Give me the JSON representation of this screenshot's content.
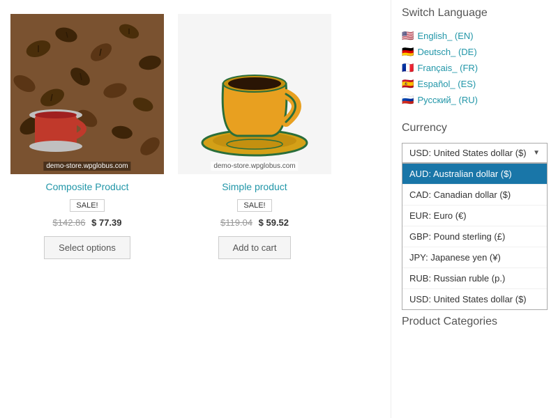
{
  "sidebar": {
    "switch_language_title": "Switch Language",
    "languages": [
      {
        "flag": "🇺🇸",
        "label": "English_ (EN)"
      },
      {
        "flag": "🇩🇪",
        "label": "Deutsch_ (DE)"
      },
      {
        "flag": "🇫🇷",
        "label": "Français_ (FR)"
      },
      {
        "flag": "🇪🇸",
        "label": "Español_ (ES)"
      },
      {
        "flag": "🇷🇺",
        "label": "Русский_ (RU)"
      }
    ],
    "currency_title": "Currency",
    "currency_selected": "USD: United States dollar ($)",
    "currency_options": [
      {
        "label": "AUD: Australian dollar ($)",
        "highlighted": true
      },
      {
        "label": "CAD: Canadian dollar ($)",
        "highlighted": false
      },
      {
        "label": "EUR: Euro (€)",
        "highlighted": false
      },
      {
        "label": "GBP: Pound sterling (£)",
        "highlighted": false
      },
      {
        "label": "JPY: Japanese yen (¥)",
        "highlighted": false
      },
      {
        "label": "RUB: Russian ruble (р.)",
        "highlighted": false
      },
      {
        "label": "USD: United States dollar ($)",
        "highlighted": false
      }
    ],
    "product_categories_title": "Product Categories"
  },
  "products": [
    {
      "title": "Composite Product",
      "badge": "SALE!",
      "old_price": "$142.86",
      "new_price": "$ 77.39",
      "button": "Select options",
      "watermark": "demo-store.wpglobus.com",
      "type": "beans"
    },
    {
      "title": "Simple product",
      "badge": "SALE!",
      "old_price": "$119.04",
      "new_price": "$ 59.52",
      "button": "Add to cart",
      "watermark": "demo-store.wpglobus.com",
      "type": "cup"
    }
  ]
}
